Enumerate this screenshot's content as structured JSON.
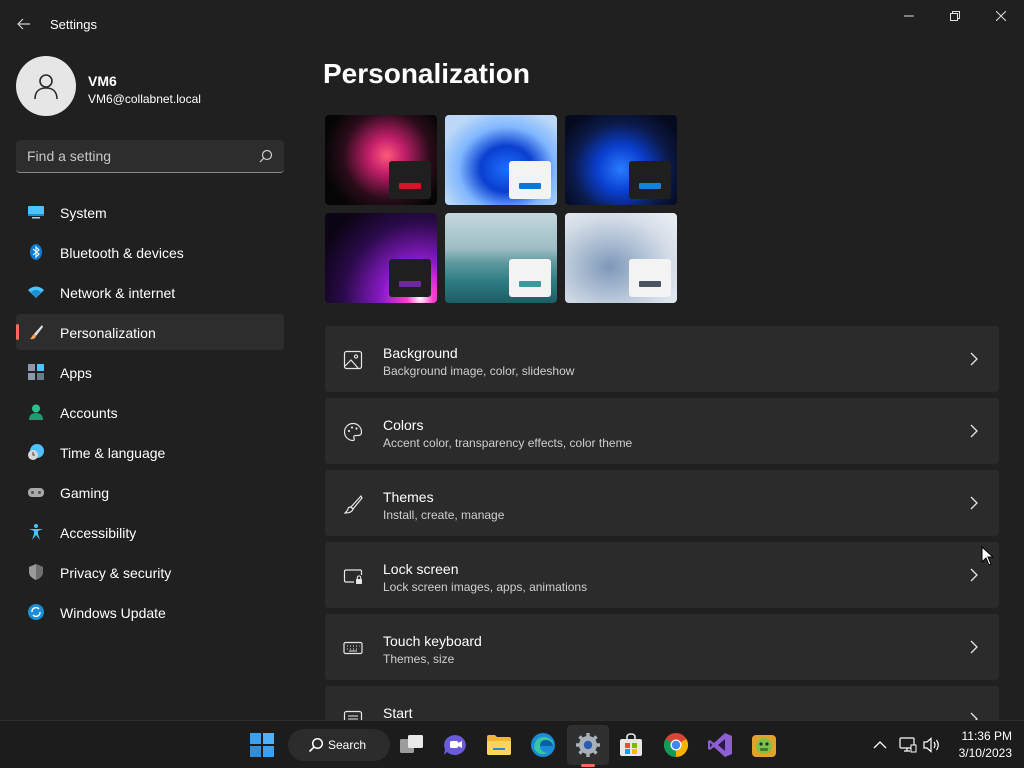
{
  "window": {
    "title": "Settings",
    "back_icon": "back-arrow-icon",
    "controls": {
      "minimize": "—",
      "maximize": "❐",
      "close": "✕"
    }
  },
  "user": {
    "name": "VM6",
    "email": "VM6@collabnet.local"
  },
  "search": {
    "placeholder": "Find a setting",
    "value": ""
  },
  "sidebar": {
    "items": [
      {
        "label": "System",
        "icon": "system-icon",
        "active": false
      },
      {
        "label": "Bluetooth & devices",
        "icon": "bluetooth-icon",
        "active": false
      },
      {
        "label": "Network & internet",
        "icon": "wifi-icon",
        "active": false
      },
      {
        "label": "Personalization",
        "icon": "brush-icon",
        "active": true
      },
      {
        "label": "Apps",
        "icon": "apps-icon",
        "active": false
      },
      {
        "label": "Accounts",
        "icon": "accounts-icon",
        "active": false
      },
      {
        "label": "Time & language",
        "icon": "clock-globe-icon",
        "active": false
      },
      {
        "label": "Gaming",
        "icon": "gamepad-icon",
        "active": false
      },
      {
        "label": "Accessibility",
        "icon": "accessibility-icon",
        "active": false
      },
      {
        "label": "Privacy & security",
        "icon": "shield-icon",
        "active": false
      },
      {
        "label": "Windows Update",
        "icon": "update-icon",
        "active": false
      }
    ]
  },
  "main": {
    "title": "Personalization",
    "themes": [
      {
        "name": "glow-dark",
        "accent": "#d2162a"
      },
      {
        "name": "bloom-light",
        "accent": "#0a78d4"
      },
      {
        "name": "bloom-dark",
        "accent": "#1a7fd6"
      },
      {
        "name": "sunrise-dark",
        "accent": "#6c2a9c"
      },
      {
        "name": "captured-motion",
        "accent": "#3d9a9a"
      },
      {
        "name": "flow-light",
        "accent": "#4a5360"
      }
    ],
    "cards": [
      {
        "title": "Background",
        "subtitle": "Background image, color, slideshow",
        "icon": "picture-icon"
      },
      {
        "title": "Colors",
        "subtitle": "Accent color, transparency effects, color theme",
        "icon": "palette-icon"
      },
      {
        "title": "Themes",
        "subtitle": "Install, create, manage",
        "icon": "brush-icon"
      },
      {
        "title": "Lock screen",
        "subtitle": "Lock screen images, apps, animations",
        "icon": "lock-screen-icon"
      },
      {
        "title": "Touch keyboard",
        "subtitle": "Themes, size",
        "icon": "keyboard-icon"
      },
      {
        "title": "Start",
        "subtitle": "",
        "icon": "start-icon"
      }
    ]
  },
  "taskbar": {
    "search_label": "Search",
    "pinned": [
      "start-icon",
      "task-view-icon",
      "teams-chat-icon",
      "file-explorer-icon",
      "edge-icon",
      "settings-icon",
      "store-icon",
      "chrome-icon",
      "visual-studio-icon",
      "game-icon"
    ],
    "tray": {
      "time": "11:36 PM",
      "date": "3/10/2023"
    }
  },
  "colors": {
    "background": "#202020",
    "accent_selection": "#f46a5e",
    "card": "#2b2b2b"
  }
}
